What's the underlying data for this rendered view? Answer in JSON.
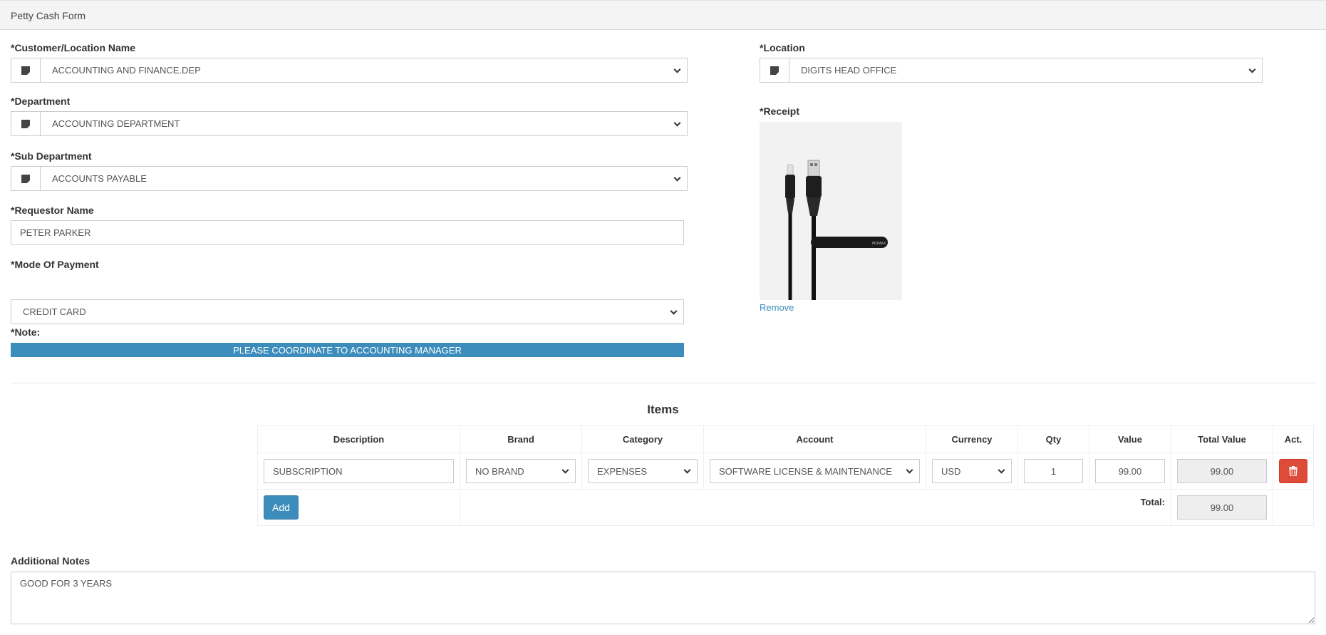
{
  "header": {
    "title": "Petty Cash Form"
  },
  "form": {
    "customer": {
      "label": "*Customer/Location Name",
      "value": "ACCOUNTING AND FINANCE.DEP"
    },
    "department": {
      "label": "*Department",
      "value": "ACCOUNTING DEPARTMENT"
    },
    "sub_department": {
      "label": "*Sub Department",
      "value": "ACCOUNTS PAYABLE"
    },
    "requestor": {
      "label": "*Requestor Name",
      "value": "PETER PARKER"
    },
    "mode_of_payment": {
      "label": "*Mode Of Payment",
      "value": "CREDIT CARD"
    },
    "note": {
      "label": "*Note:",
      "value": "PLEASE COORDINATE TO ACCOUNTING MANAGER"
    },
    "location": {
      "label": "*Location",
      "value": "DIGITS HEAD OFFICE"
    },
    "receipt": {
      "label": "*Receipt",
      "remove_label": "Remove",
      "product_text": "MOMAX"
    }
  },
  "items": {
    "title": "Items",
    "columns": [
      "Description",
      "Brand",
      "Category",
      "Account",
      "Currency",
      "Qty",
      "Value",
      "Total Value",
      "Act."
    ],
    "rows": [
      {
        "description": "SUBSCRIPTION",
        "brand": "NO BRAND",
        "category": "EXPENSES",
        "account": "SOFTWARE LICENSE & MAINTENANCE",
        "currency": "USD",
        "qty": "1",
        "value": "99.00",
        "total_value": "99.00"
      }
    ],
    "add_label": "Add",
    "total_label": "Total:",
    "total_value": "99.00"
  },
  "additional_notes": {
    "label": "Additional Notes",
    "value": "GOOD FOR 3 YEARS"
  },
  "colors": {
    "primary": "#3c8dbc",
    "danger": "#dd4b39",
    "header_bg": "#f4f4f4"
  }
}
